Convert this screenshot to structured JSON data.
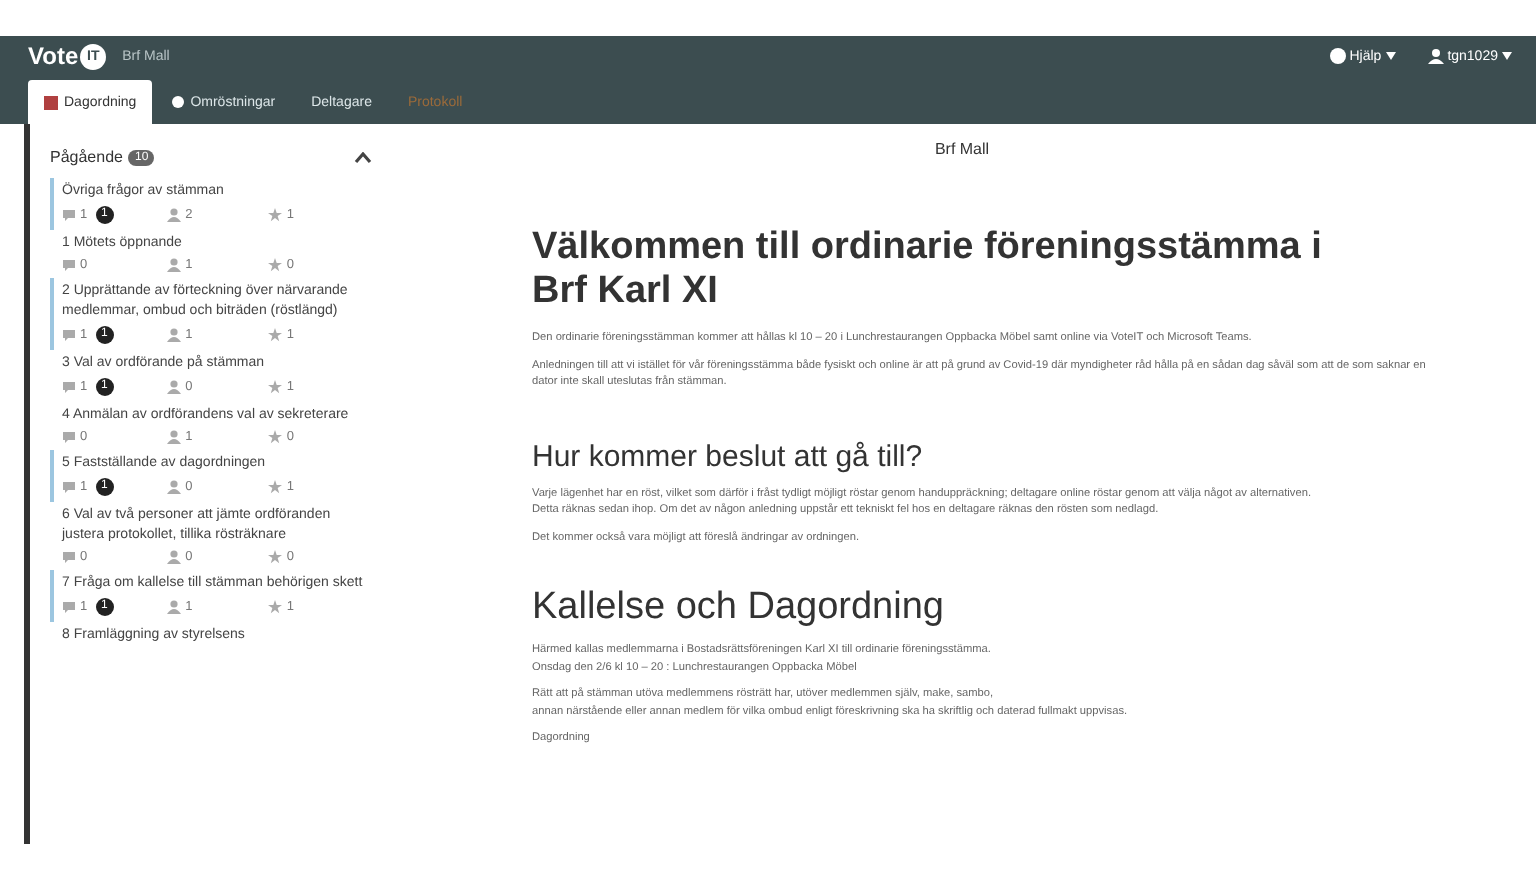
{
  "header": {
    "logo": {
      "text": "Vote",
      "mark": "IT"
    },
    "meeting": "Brf Mall",
    "help": "Hjälp",
    "user": "tgn1029"
  },
  "tabs": [
    {
      "label": "Dagordning",
      "kind": "list",
      "selected": true,
      "color": "#333333"
    },
    {
      "label": "Omröstningar",
      "kind": "dot",
      "selected": false,
      "color": "#dce6e8"
    },
    {
      "label": "Deltagare",
      "kind": "plain",
      "selected": false,
      "color": "#dce6e8"
    },
    {
      "label": "Protokoll",
      "kind": "plain",
      "selected": false,
      "color": "#9a6a3a"
    }
  ],
  "sidebar": {
    "title": "Pågående",
    "count": "10",
    "expanded": true,
    "items": [
      {
        "title": "Övriga frågor av stämman",
        "highlighted": true,
        "comments": "1",
        "badge": "1",
        "participants": "2",
        "stars": "1"
      },
      {
        "title": "1 Mötets öppnande",
        "highlighted": false,
        "comments": "0",
        "participants": "1",
        "stars": "0"
      },
      {
        "title": "2 Upprättande av förteckning över närvarande medlemmar, ombud och biträden (röstlängd)",
        "highlighted": true,
        "comments": "1",
        "badge": "1",
        "participants": "1",
        "stars": "1"
      },
      {
        "title": "3 Val av ordförande på stämman",
        "highlighted": false,
        "comments": "1",
        "badge": "1",
        "participants": "0",
        "stars": "1"
      },
      {
        "title": "4 Anmälan av ordförandens val av sekreterare",
        "highlighted": false,
        "comments": "0",
        "participants": "1",
        "stars": "0"
      },
      {
        "title": "5 Fastställande av dagordningen",
        "highlighted": true,
        "comments": "1",
        "badge": "1",
        "participants": "0",
        "stars": "1"
      },
      {
        "title": "6 Val av två personer att jämte ordföranden justera protokollet, tillika rösträknare",
        "highlighted": false,
        "comments": "0",
        "participants": "0",
        "stars": "0"
      },
      {
        "title": "7 Fråga om kallelse till stämman behörigen skett",
        "highlighted": true,
        "comments": "1",
        "badge": "1",
        "participants": "1",
        "stars": "1"
      },
      {
        "title": "8 Framläggning av styrelsens",
        "highlighted": false
      }
    ]
  },
  "main": {
    "meeting_title": "Brf Mall",
    "sections": [
      {
        "heading": "Välkommen till ordinarie föreningsstämma i Brf Karl XI",
        "kind": "title",
        "paragraphs": [
          [
            "Den ordinarie föreningsstämman kommer att hållas kl 10 – 20 i Lunchrestaurangen Oppbacka Möbel samt online via VoteIT och Microsoft Teams."
          ],
          [
            "Anledningen till att vi istället för vår föreningsstämma både fysiskt och online är att på grund av Covid-19 där myndigheter råd hålla på en sådan dag såväl som att de som saknar en dator inte skall uteslutas från stämman."
          ]
        ]
      },
      {
        "heading": "Hur kommer beslut att gå till?",
        "kind": "heading",
        "paragraphs": [
          [
            "Varje lägenhet har en röst, vilket som därför i fråst tydligt möjligt röstar genom handuppräckning; deltagare online röstar genom att välja något av alternativen.",
            "Detta räknas sedan ihop. Om det av någon anledning uppstår ett tekniskt fel hos en deltagare räknas den rösten som nedlagd."
          ],
          [
            "Det kommer också vara möjligt att föreslå ändringar av ordningen."
          ]
        ]
      },
      {
        "heading": "Kallelse och Dagordning",
        "kind": "heading",
        "paragraphs": [
          [
            "Härmed kallas medlemmarna i Bostadsrättsföreningen Karl XI till ordinarie föreningsstämma.",
            "Onsdag den 2/6 kl 10 – 20 : Lunchrestaurangen Oppbacka Möbel"
          ],
          [
            "Rätt att på stämman utöva medlemmens rösträtt har, utöver medlemmen själv, make, sambo,",
            "annan närstående eller annan medlem för vilka ombud enligt föreskrivning ska ha skriftlig och daterad fullmakt uppvisas."
          ],
          [
            "Dagordning"
          ]
        ]
      }
    ]
  }
}
